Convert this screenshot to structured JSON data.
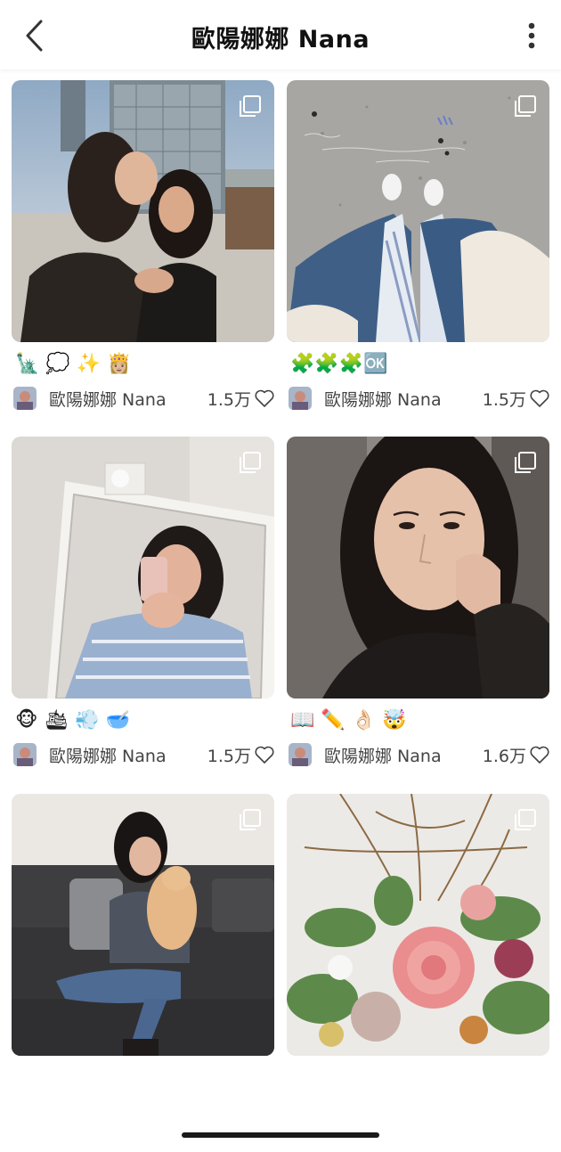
{
  "header": {
    "title": "歐陽娜娜 Nana",
    "back_icon": "chevron-left-icon",
    "more_icon": "vertical-ellipsis-icon"
  },
  "posts": [
    {
      "emojis": "🗽 💭 ✨ 👸🏼",
      "author": "歐陽娜娜 Nana",
      "likes": "1.5万"
    },
    {
      "emojis": "🧩🧩🧩🆗",
      "author": "歐陽娜娜 Nana",
      "likes": "1.5万"
    },
    {
      "emojis": "🐵 🛳 💨 🥣",
      "author": "歐陽娜娜 Nana",
      "likes": "1.5万"
    },
    {
      "emojis": "📖 ✏️ 👌🏻 🤯",
      "author": "歐陽娜娜 Nana",
      "likes": "1.6万"
    },
    {
      "emojis": "",
      "author": "",
      "likes": ""
    },
    {
      "emojis": "",
      "author": "",
      "likes": ""
    }
  ],
  "icons": {
    "multi_image": "multi-image-icon",
    "like": "heart-outline-icon"
  }
}
